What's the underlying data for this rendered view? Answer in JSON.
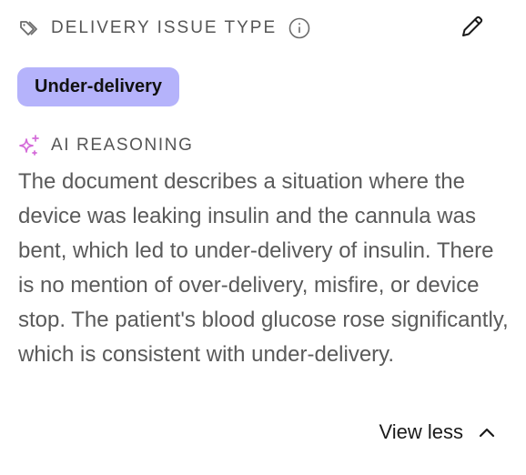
{
  "field": {
    "title": "DELIVERY ISSUE TYPE",
    "value_badge": "Under-delivery",
    "badge_color": "#b5b3fb"
  },
  "icons": {
    "tag": "tag-icon",
    "info": "info-icon",
    "edit": "pencil-icon",
    "ai": "sparkle-icon",
    "collapse": "chevron-up-icon"
  },
  "ai_reasoning": {
    "title": "AI REASONING",
    "accent_color": "#d46bd9",
    "text": "The document describes a situation where the device was leaking insulin and the cannula was bent, which led to under-delivery of insulin. There is no mention of over-delivery, misfire, or device stop. The patient's blood glucose rose significantly, which is consistent with under-delivery."
  },
  "actions": {
    "view_less_label": "View less"
  }
}
